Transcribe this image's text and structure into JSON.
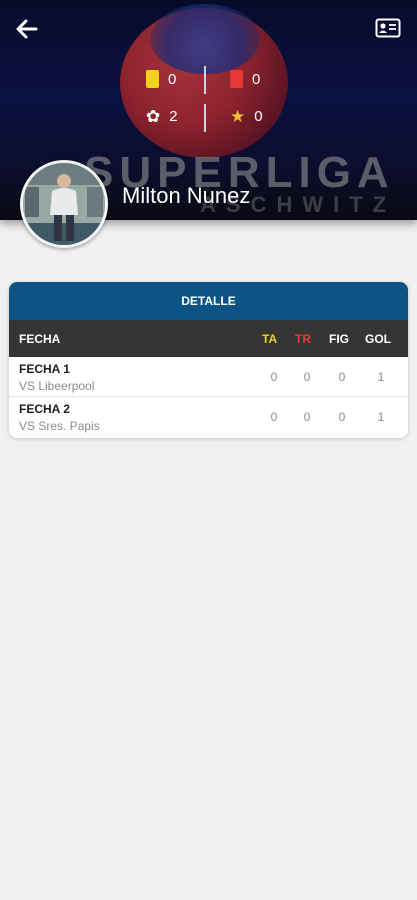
{
  "header": {
    "brand": "SUPERLIGA",
    "brand_sub": "ASCHWITZ",
    "player_name": "Milton Nunez",
    "back_icon": "arrow-left-icon",
    "card_icon": "id-card-icon"
  },
  "stats": {
    "yellow_cards": "0",
    "red_cards": "0",
    "figures": "2",
    "stars": "0"
  },
  "table": {
    "title": "DETALLE",
    "columns": {
      "fecha": "FECHA",
      "ta": "TA",
      "tr": "TR",
      "fig": "FIG",
      "gol": "GOL"
    },
    "rows": [
      {
        "fecha": "FECHA 1",
        "rival": "VS Libeerpool",
        "ta": "0",
        "tr": "0",
        "fig": "0",
        "gol": "1"
      },
      {
        "fecha": "FECHA 2",
        "rival": "VS Sres. Papis",
        "ta": "0",
        "tr": "0",
        "fig": "0",
        "gol": "1"
      }
    ]
  },
  "colors": {
    "table_header": "#0b5384",
    "ta_color": "#f2d21b",
    "tr_color": "#e53935",
    "column_header_bg": "#353535"
  }
}
